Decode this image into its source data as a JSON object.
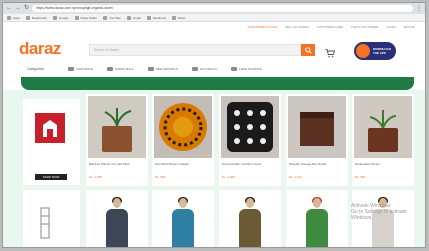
{
  "browser": {
    "url": "https://www.daraz.com.np/shop/tgb-organic-store/",
    "bookmarks": [
      "Apps",
      "Bookmarks",
      "Google",
      "Daraz Seller",
      "YouTube",
      "Gmail",
      "Facebook",
      "Other"
    ]
  },
  "topstrip": {
    "links": [
      "SAVE MORE ON APP",
      "SELL ON DARAZ",
      "CUSTOMER CARE",
      "TRACK MY ORDER",
      "LOGIN",
      "SIGNUP"
    ]
  },
  "header": {
    "logo": "daraz",
    "search_placeholder": "Search in Daraz",
    "promo_line1": "DOWNLOAD",
    "promo_line2": "THE APP",
    "search_icon": "search-icon",
    "cart_icon": "cart-icon"
  },
  "catbar": {
    "label": "Categories",
    "items": [
      "LOW PRICE",
      "DARAZ MALL",
      "NEW ARRIVALS",
      "HOT DEALS",
      "FREE SHIPPING"
    ]
  },
  "brand": {
    "shop_label": "SHOP NOW"
  },
  "products": [
    {
      "name": "Bamboo Planter Pot with Plant",
      "price": "Rs. 1,450",
      "img": "#8c5230"
    },
    {
      "name": "Sun Motif Woven Coaster",
      "price": "Rs. 650",
      "img": "#d97a00"
    },
    {
      "name": "Printed Fabric Cushion Cover",
      "price": "Rs. 1,250",
      "img": "#1a1a1a"
    },
    {
      "name": "Wooden Storage Box Small",
      "price": "Rs. 1,100",
      "img": "#5a3020"
    },
    {
      "name": "Handmade Planter",
      "price": "Rs. 950",
      "img": "#6b3520"
    }
  ],
  "apparel": [
    {
      "shirt": "#3b4756"
    },
    {
      "shirt": "#2f7fa3"
    },
    {
      "shirt": "#6b5a33"
    },
    {
      "shirt": "#3e8a3e"
    },
    {
      "shirt": "#d8d2cc"
    }
  ],
  "watermark": {
    "line1": "Activate Windows",
    "line2": "Go to Settings to activate Windows."
  },
  "colors": {
    "brand_orange": "#f57224",
    "banner_green": "#1f7a46",
    "mint_bg": "#e9f7ee"
  }
}
